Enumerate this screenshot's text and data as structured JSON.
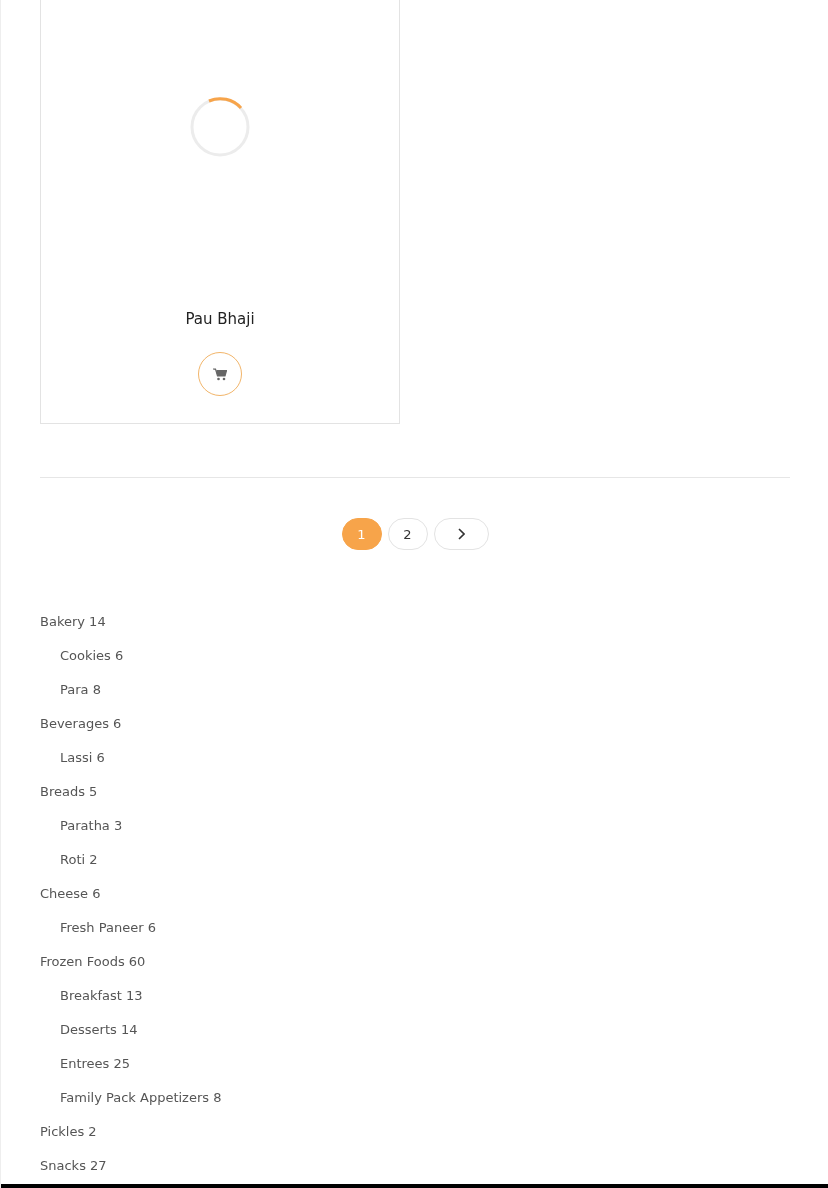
{
  "product": {
    "name": "Pau Bhaji"
  },
  "pagination": {
    "pages": [
      {
        "label": "1",
        "selected": true
      },
      {
        "label": "2",
        "selected": false
      }
    ]
  },
  "categories": [
    {
      "name": "Bakery",
      "count": "14",
      "children": [
        {
          "name": "Cookies",
          "count": "6"
        },
        {
          "name": "Para",
          "count": "8"
        }
      ]
    },
    {
      "name": "Beverages",
      "count": "6",
      "children": [
        {
          "name": "Lassi",
          "count": "6"
        }
      ]
    },
    {
      "name": "Breads",
      "count": "5",
      "children": [
        {
          "name": "Paratha",
          "count": "3"
        },
        {
          "name": "Roti",
          "count": "2"
        }
      ]
    },
    {
      "name": "Cheese",
      "count": "6",
      "children": [
        {
          "name": "Fresh Paneer",
          "count": "6"
        }
      ]
    },
    {
      "name": "Frozen Foods",
      "count": "60",
      "children": [
        {
          "name": "Breakfast",
          "count": "13"
        },
        {
          "name": "Desserts",
          "count": "14"
        },
        {
          "name": "Entrees",
          "count": "25"
        },
        {
          "name": "Family Pack Appetizers",
          "count": "8"
        }
      ]
    },
    {
      "name": "Pickles",
      "count": "2"
    },
    {
      "name": "Snacks",
      "count": "27"
    }
  ]
}
